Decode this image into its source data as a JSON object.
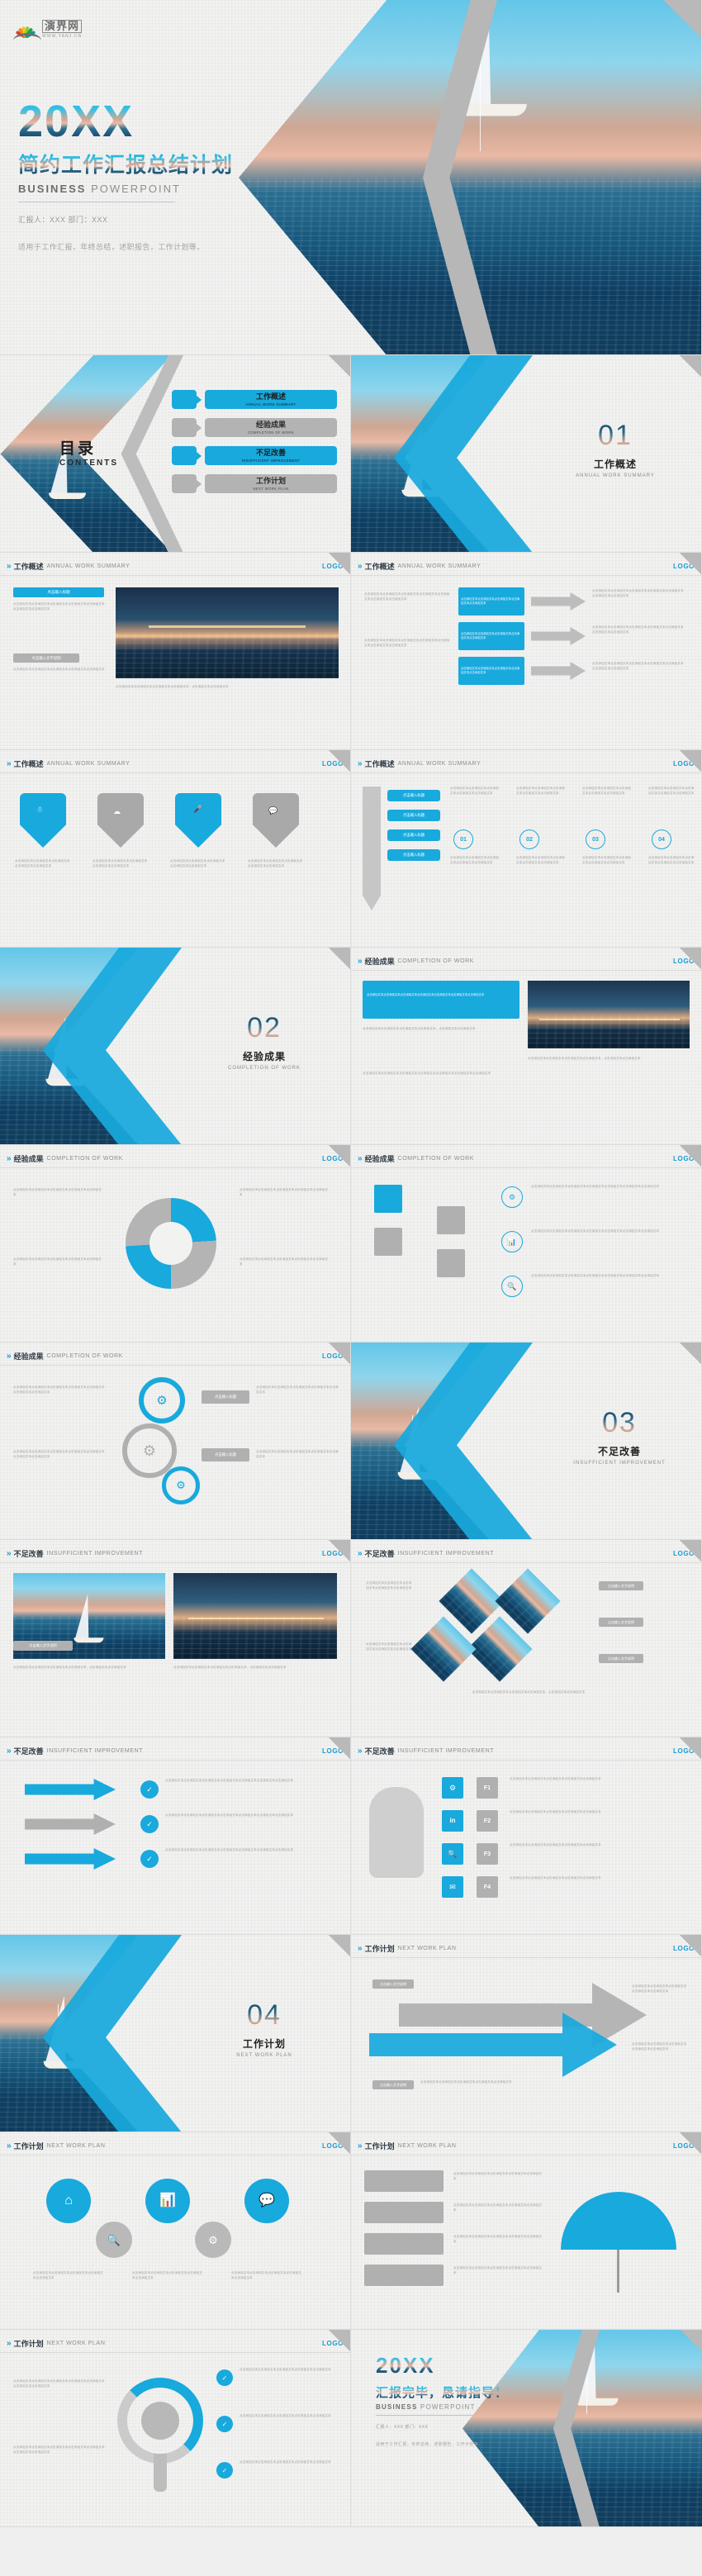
{
  "brand": {
    "logo_cn": "演界网",
    "logo_url": "WWW.YANJ.CN",
    "logo_text": "LOGO",
    "accent": "#18a9dd",
    "grey": "#b3b3b3",
    "dark": "#2f3b44"
  },
  "title_slide": {
    "year": "20XX",
    "title_cn": "简约工作汇报总结计划",
    "subtitle_bold": "BUSINESS",
    "subtitle_rest": " POWERPOINT",
    "meta": "汇报人：XXX    部门：XXX",
    "desc": "适用于工作汇报，年终总结，述职报告，工作计划等。"
  },
  "contents_slide": {
    "heading_cn": "目录",
    "heading_en": "CONTENTS",
    "items": [
      {
        "num": "01",
        "cn": "工作概述",
        "en": "ANNUAL WORK SUMMARY",
        "style": "blue"
      },
      {
        "num": "02",
        "cn": "经验成果",
        "en": "COMPLETION OF WORK",
        "style": "grey"
      },
      {
        "num": "03",
        "cn": "不足改善",
        "en": "INSUFFICIENT IMPROVEMENT",
        "style": "blue"
      },
      {
        "num": "04",
        "cn": "工作计划",
        "en": "NEXT  WORK PLAN",
        "style": "grey"
      }
    ]
  },
  "sections": [
    {
      "num": "01",
      "cn": "工作概述",
      "en": "ANNUAL WORK SUMMARY"
    },
    {
      "num": "02",
      "cn": "经验成果",
      "en": "COMPLETION OF WORK"
    },
    {
      "num": "03",
      "cn": "不足改善",
      "en": "INSUFFICIENT IMPROVEMENT"
    },
    {
      "num": "04",
      "cn": "工作计划",
      "en": "NEXT  WORK PLAN"
    }
  ],
  "headers": {
    "s1": {
      "cn": "工作概述",
      "en": "ANNUAL WORK SUMMARY"
    },
    "s2": {
      "cn": "经验成果",
      "en": "COMPLETION OF WORK"
    },
    "s3": {
      "cn": "不足改善",
      "en": "INSUFFICIENT IMPROVEMENT"
    },
    "s4": {
      "cn": "工作计划",
      "en": "NEXT  WORK PLAN"
    }
  },
  "placeholder": {
    "title": "点击输入标题",
    "short": "点击输入标题",
    "body": "点击添加文本点击添加文本点击添加文本点击添加文本点击添加文本点击添加文本点击添加文本",
    "body2": "点击添加文本点击添加文本点击添加文本点击添加文本点击添加文本",
    "caption": "点击输入文字说明",
    "center": "点击添加文本点击添加文本点击添加文本点击添加文本，点击添加文本点击添加文本"
  },
  "end_slide": {
    "year": "20XX",
    "title_cn": "汇报完毕，恳请指导！",
    "subtitle_bold": "BUSINESS",
    "subtitle_rest": " POWERPOINT",
    "meta": "汇报人：XXX    部门：XXX",
    "desc": "适用于工作汇报，年终总结，述职报告，工作计划等。"
  },
  "numbers": {
    "n1": "01",
    "n2": "02",
    "n3": "03",
    "n4": "04",
    "f1": "F1",
    "f2": "F2",
    "f3": "F3",
    "f4": "F4"
  },
  "icons": {
    "location": "location-pin-icon",
    "cloud": "cloud-icon",
    "mic": "microphone-icon",
    "chat": "chat-bubble-icon",
    "gear": "gear-icon",
    "chart": "bar-chart-icon",
    "search": "magnifier-icon",
    "home": "home-icon",
    "check": "check-icon",
    "umbrella": "umbrella-icon",
    "in": "linkedin-icon",
    "mail": "mail-icon",
    "phone": "phone-icon"
  }
}
